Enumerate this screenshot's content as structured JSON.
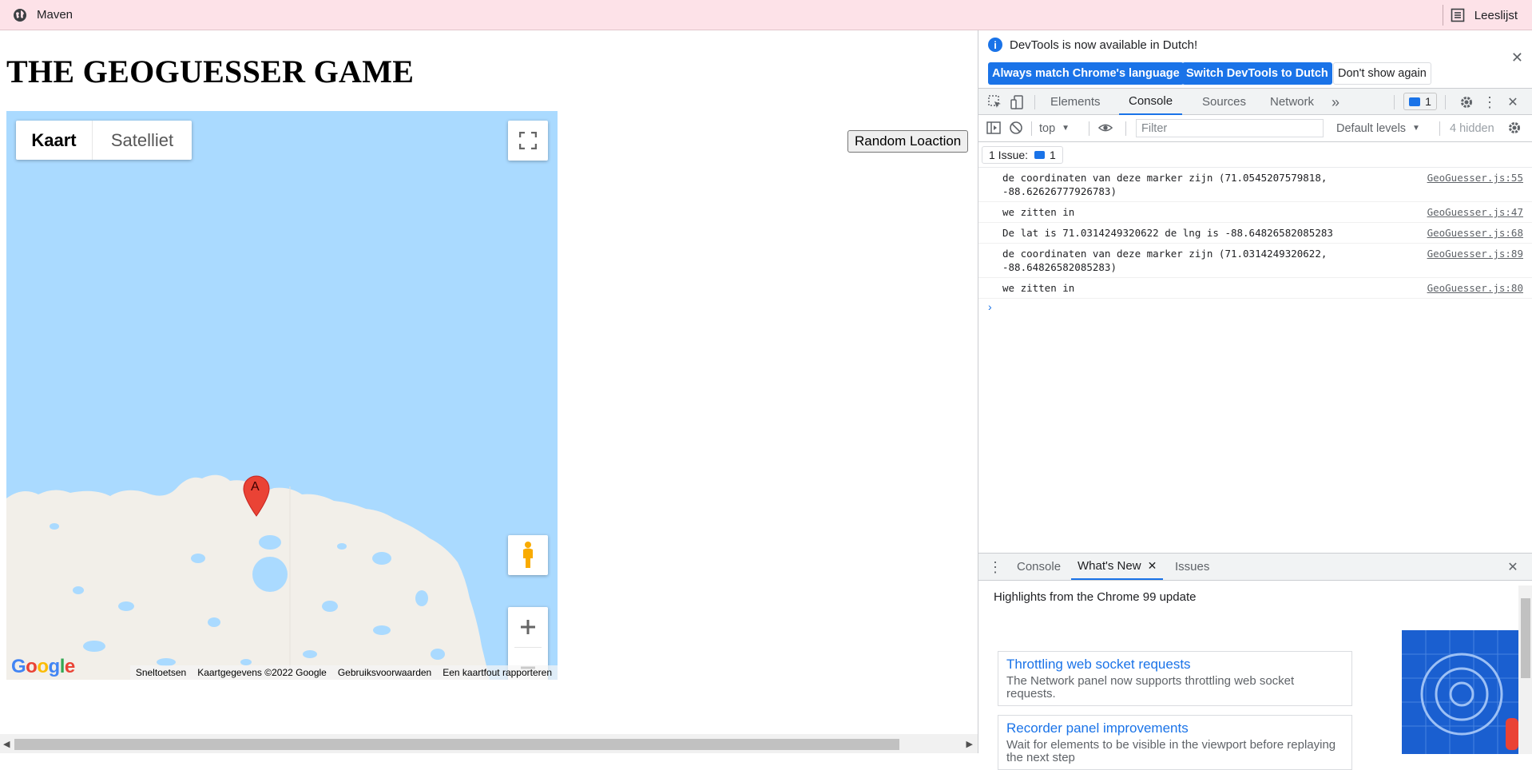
{
  "bookmarks": {
    "left_label": "Maven",
    "left_icon": "globe-icon",
    "right_label": "Leeslijst",
    "right_icon": "reading-list-icon"
  },
  "page": {
    "title": "THE GEOGUESSER GAME",
    "random_button": "Random Loaction",
    "map": {
      "type_map": "Kaart",
      "type_satellite": "Satelliet",
      "marker_label": "A",
      "logo": "Google",
      "attribution": [
        "Sneltoetsen",
        "Kaartgegevens ©2022 Google",
        "Gebruiksvoorwaarden",
        "Een kaartfout rapporteren"
      ],
      "water_color": "#aadaff",
      "land_color": "#f2efe9",
      "marker_color": "#ea4335"
    }
  },
  "devtools": {
    "info": {
      "message": "DevTools is now available in Dutch!",
      "btn_match": "Always match Chrome's language",
      "btn_switch": "Switch DevTools to Dutch",
      "btn_dismiss": "Don't show again"
    },
    "tabs": [
      "Elements",
      "Console",
      "Sources",
      "Network"
    ],
    "active_tab": "Console",
    "issues_badge": "1",
    "filter": {
      "context": "top",
      "placeholder": "Filter",
      "levels": "Default levels",
      "hidden": "4 hidden"
    },
    "issue_bar": {
      "label": "1 Issue:",
      "count": "1"
    },
    "logs": [
      {
        "msg": "de coordinaten van deze marker zijn (71.0545207579818,\n-88.62626777926783)",
        "src": "GeoGuesser.js:55"
      },
      {
        "msg": "we zitten in",
        "src": "GeoGuesser.js:47"
      },
      {
        "msg": "De lat is 71.0314249320622 de lng is -88.64826582085283",
        "src": "GeoGuesser.js:68"
      },
      {
        "msg": "de coordinaten van deze marker zijn (71.0314249320622,\n-88.64826582085283)",
        "src": "GeoGuesser.js:89"
      },
      {
        "msg": "we zitten in",
        "src": "GeoGuesser.js:80"
      }
    ],
    "prompt": "›",
    "drawer": {
      "tabs": [
        "Console",
        "What's New",
        "Issues"
      ],
      "active_tab": "What's New",
      "heading": "Highlights from the Chrome 99 update",
      "cards": [
        {
          "title": "Throttling web socket requests",
          "desc": "The Network panel now supports throttling web socket requests."
        },
        {
          "title": "Recorder panel improvements",
          "desc": "Wait for elements to be visible in the viewport before replaying the next step"
        }
      ]
    },
    "accent": "#1a73e8"
  }
}
